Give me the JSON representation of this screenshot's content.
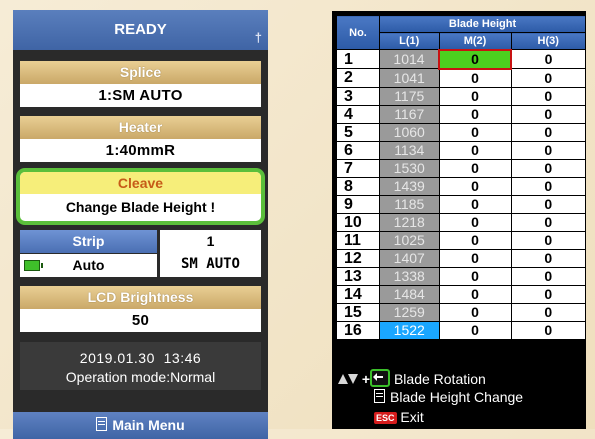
{
  "left": {
    "status_title": "READY",
    "bluetooth_icon": "bluetooth-icon",
    "splice": {
      "label": "Splice",
      "value": "1:SM AUTO"
    },
    "heater": {
      "label": "Heater",
      "value": "1:40mmR"
    },
    "cleave": {
      "label": "Cleave",
      "value": "Change Blade Height !"
    },
    "strip": {
      "label": "Strip",
      "value": "Auto",
      "right_top": "1",
      "right_bottom": "SM AUTO"
    },
    "lcd": {
      "label": "LCD Brightness",
      "value": "50"
    },
    "datetime": "2019.01.30  13:46",
    "mode": "Operation mode:Normal",
    "main_menu": "Main Menu"
  },
  "right": {
    "title": "Blade Height",
    "col_no": "No.",
    "cols": [
      "L(1)",
      "M(2)",
      "H(3)"
    ],
    "rows": [
      {
        "no": "1",
        "l": "1014",
        "m": "0",
        "h": "0"
      },
      {
        "no": "2",
        "l": "1041",
        "m": "0",
        "h": "0"
      },
      {
        "no": "3",
        "l": "1175",
        "m": "0",
        "h": "0"
      },
      {
        "no": "4",
        "l": "1167",
        "m": "0",
        "h": "0"
      },
      {
        "no": "5",
        "l": "1060",
        "m": "0",
        "h": "0"
      },
      {
        "no": "6",
        "l": "1134",
        "m": "0",
        "h": "0"
      },
      {
        "no": "7",
        "l": "1530",
        "m": "0",
        "h": "0"
      },
      {
        "no": "8",
        "l": "1439",
        "m": "0",
        "h": "0"
      },
      {
        "no": "9",
        "l": "1185",
        "m": "0",
        "h": "0"
      },
      {
        "no": "10",
        "l": "1218",
        "m": "0",
        "h": "0"
      },
      {
        "no": "11",
        "l": "1025",
        "m": "0",
        "h": "0"
      },
      {
        "no": "12",
        "l": "1407",
        "m": "0",
        "h": "0"
      },
      {
        "no": "13",
        "l": "1338",
        "m": "0",
        "h": "0"
      },
      {
        "no": "14",
        "l": "1484",
        "m": "0",
        "h": "0"
      },
      {
        "no": "15",
        "l": "1259",
        "m": "0",
        "h": "0"
      },
      {
        "no": "16",
        "l": "1522",
        "m": "0",
        "h": "0"
      }
    ],
    "help": {
      "rotation": "Blade Rotation",
      "height_change": "Blade Height Change",
      "esc_key": "ESC",
      "exit": "Exit"
    }
  },
  "colors": {
    "accent_blue": "#3f64a5",
    "card_gold": "#caa868",
    "cleave_yellow": "#f6ee7a",
    "highlight_green": "#5bbf3b",
    "selected_blue": "#1aa6ff",
    "error_red": "#c81212"
  }
}
